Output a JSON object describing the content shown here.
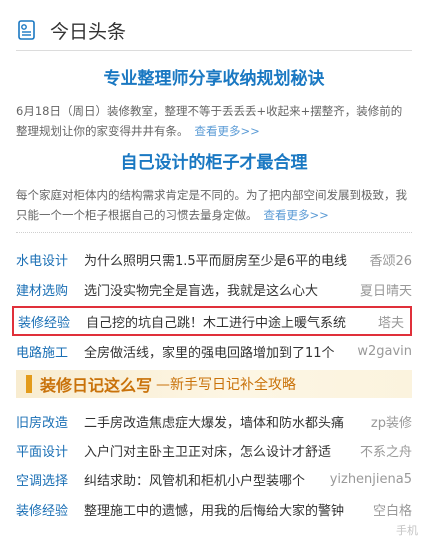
{
  "header": {
    "title": "今日头条",
    "icon": "news-icon"
  },
  "features": [
    {
      "title": "专业整理师分享收纳规划秘诀",
      "desc": "6月18日（周日）装修教室，整理不等于丢丢丢+收起来+摆整齐，装修前的整理规划让你的家变得井井有条。",
      "more": "查看更多>>"
    },
    {
      "title": "自己设计的柜子才最合理",
      "desc": "每个家庭对柜体内的结构需求肯定是不同的。为了把内部空间发展到极致，我只能一个一个柜子根据自己的习惯去量身定做。",
      "more": "查看更多>>"
    }
  ],
  "list1": [
    {
      "cat": "水电设计",
      "text": "为什么照明只需1.5平而厨房至少是6平的电线",
      "author": "香颂26"
    },
    {
      "cat": "建材选购",
      "text": "选门没实物完全是盲选，我就是这么心大",
      "author": "夏日晴天"
    },
    {
      "cat": "装修经验",
      "text": "自己挖的坑自己跳！木工进行中途上暖气系统",
      "author": "塔夫"
    },
    {
      "cat": "电路施工",
      "text": "全房做活线，家里的强电回路增加到了11个",
      "author": "w2gavin"
    }
  ],
  "banner": {
    "title": "装修日记这么写",
    "sub": "—新手写日记补全攻略"
  },
  "list2": [
    {
      "cat": "旧房改造",
      "text": "二手房改造焦虑症大爆发，墙体和防水都头痛",
      "author": "zp装修"
    },
    {
      "cat": "平面设计",
      "text": "入户门对主卧主卫正对床，怎么设计才舒适",
      "author": "不系之舟"
    },
    {
      "cat": "空调选择",
      "text": "纠结求助：风管机和柜机小户型装哪个",
      "author": "yizhenjiena5"
    },
    {
      "cat": "装修经验",
      "text": "整理施工中的遗憾，用我的后悔给大家的警钟",
      "author": "空白格"
    }
  ],
  "watermark": "手机"
}
